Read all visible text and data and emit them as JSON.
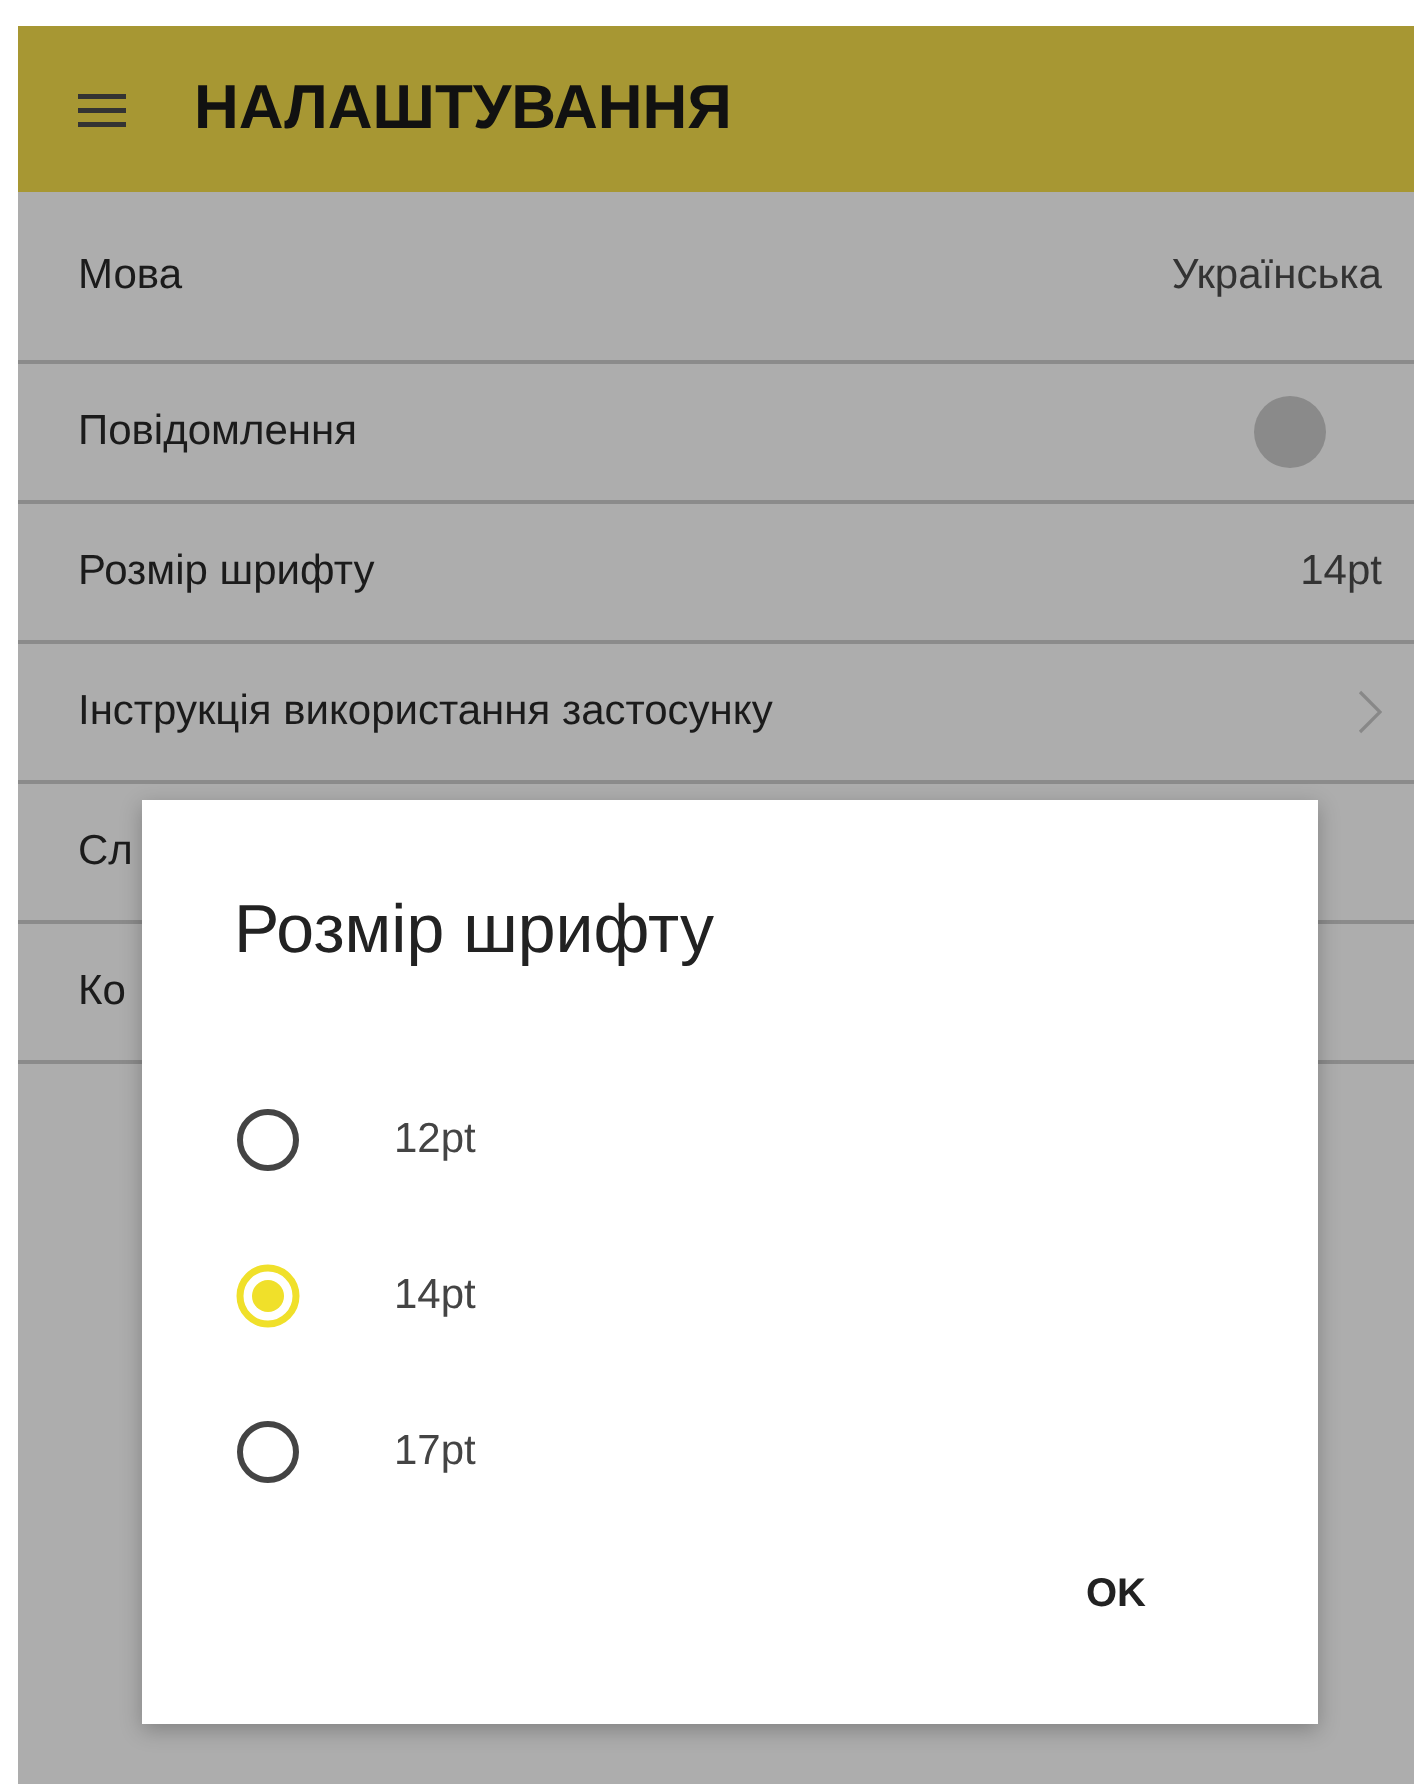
{
  "app_bar": {
    "title": "НАЛАШТУВАННЯ"
  },
  "settings": [
    {
      "kind": "value",
      "label": "Мова",
      "value": "Українська"
    },
    {
      "kind": "toggle",
      "label": "Повідомлення",
      "on": false
    },
    {
      "kind": "value",
      "label": "Розмір шрифту",
      "value": "14pt"
    },
    {
      "kind": "link",
      "label": "Інструкція використання застосунку"
    },
    {
      "kind": "plain",
      "label": "Сл"
    },
    {
      "kind": "plain",
      "label": "Ко"
    }
  ],
  "dialog": {
    "title": "Розмір шрифту",
    "options": [
      {
        "label": "12pt",
        "selected": false
      },
      {
        "label": "14pt",
        "selected": true
      },
      {
        "label": "17pt",
        "selected": false
      }
    ],
    "button": "OK"
  }
}
